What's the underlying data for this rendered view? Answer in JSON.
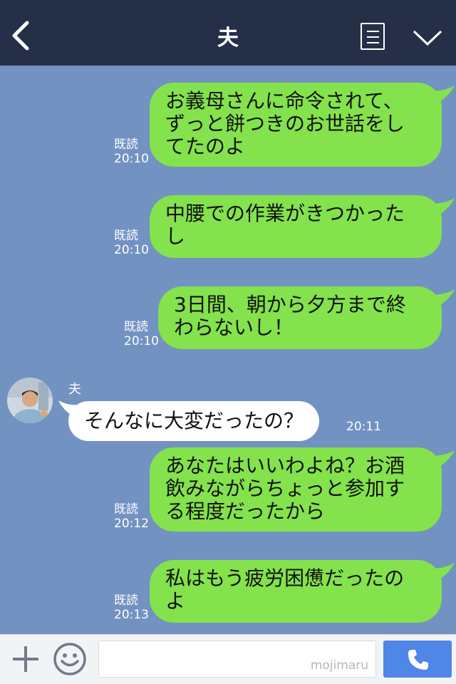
{
  "header": {
    "title": "夫"
  },
  "messages": [
    {
      "lines": [
        "お義母さんに命令されて、",
        "ずっと餅つきのお世話をし",
        "てたのよ"
      ],
      "read": "既読",
      "time": "20:10"
    },
    {
      "lines": [
        "中腰での作業がきつかった",
        "し"
      ],
      "read": "既読",
      "time": "20:10"
    },
    {
      "lines": [
        "3日間、朝から夕方まで終",
        "わらないし！"
      ],
      "read": "既読",
      "time": "20:10"
    },
    {
      "lines": [
        "あなたはいいわよね？お酒",
        "飲みながらちょっと参加す",
        "る程度だったから"
      ],
      "read": "既読",
      "time": "20:12"
    },
    {
      "lines": [
        "私はもう疲労困憊だったの",
        "よ"
      ],
      "read": "既読",
      "time": "20:13"
    }
  ],
  "friend_message": {
    "name": "夫",
    "text": "そんなに大変だったの？",
    "time": "20:11"
  },
  "input": {
    "watermark": "mojimaru"
  },
  "colors": {
    "header": "#253048",
    "chat_bg": "#7292c2",
    "my_bubble": "#84e24c",
    "friend_bubble": "#ffffff",
    "call_button": "#4f86e7"
  }
}
